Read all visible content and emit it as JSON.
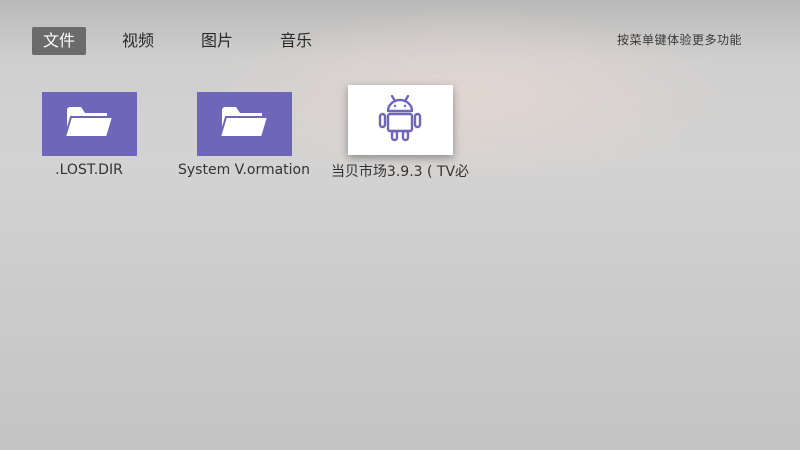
{
  "tabs": [
    {
      "label": "文件",
      "active": true
    },
    {
      "label": "视频",
      "active": false
    },
    {
      "label": "图片",
      "active": false
    },
    {
      "label": "音乐",
      "active": false
    }
  ],
  "hint": "按菜单键体验更多功能",
  "files": [
    {
      "name": ".LOST.DIR",
      "type": "folder",
      "icon": "folder-icon"
    },
    {
      "name": "System V.ormation",
      "type": "folder",
      "icon": "folder-icon"
    },
    {
      "name": "当贝市场3.9.3 ( TV必",
      "type": "apk",
      "icon": "android-icon",
      "selected": true
    }
  ],
  "colors": {
    "folder_bg": "#6e67b9",
    "active_tab_bg": "#6b6b6b",
    "apk_bg": "#ffffff"
  }
}
